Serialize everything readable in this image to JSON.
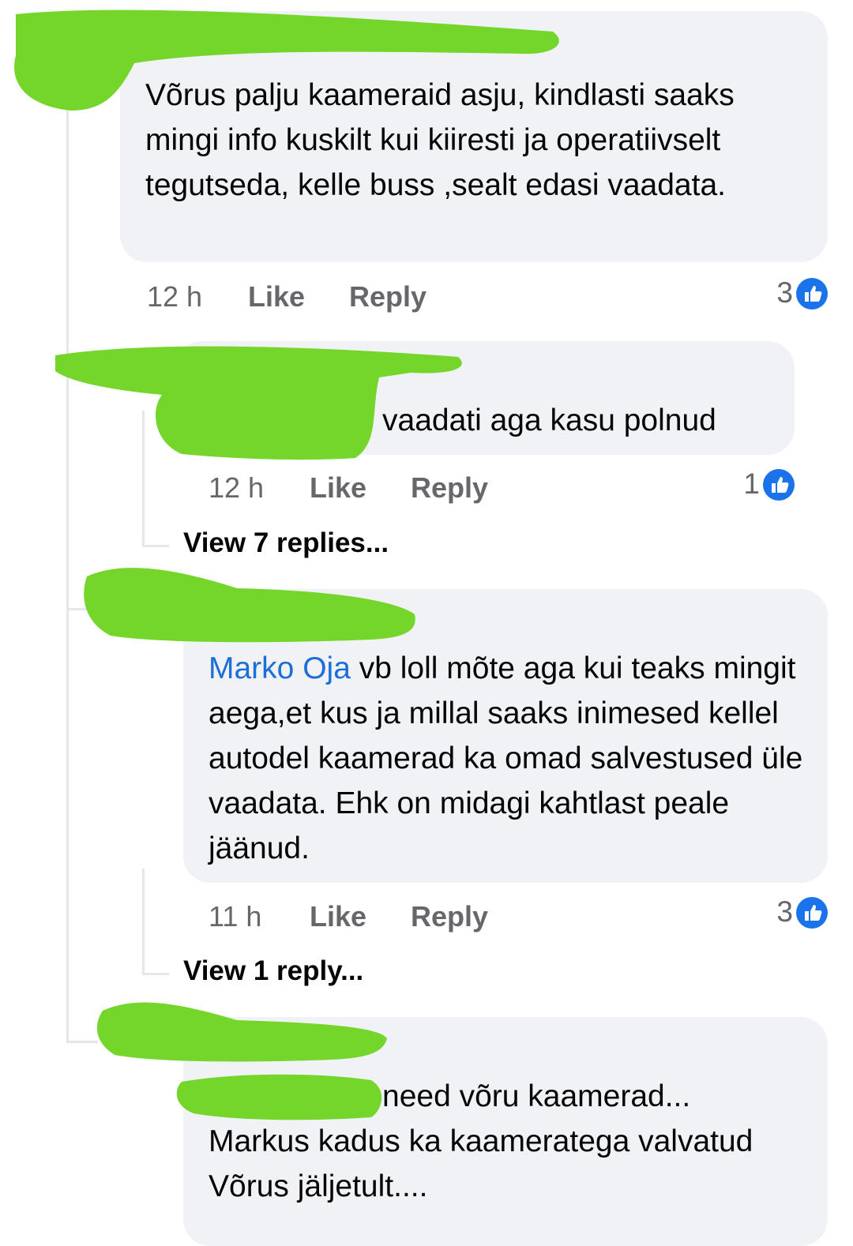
{
  "colors": {
    "bubble": "#f0f2f5",
    "mention": "#1b6fd6",
    "like_badge": "#1a73ea",
    "redaction": "#74d62a"
  },
  "comments": [
    {
      "text": "Võrus palju kaameraid asju, kindlasti saaks mingi info kuskilt kui kiiresti ja operatiivselt tegutseda, kelle buss ,sealt edasi vaadata.",
      "time": "12 h",
      "like_label": "Like",
      "reply_label": "Reply",
      "reactions": "3"
    },
    {
      "text": "vaadati aga kasu polnud",
      "time": "12 h",
      "like_label": "Like",
      "reply_label": "Reply",
      "reactions": "1",
      "view_replies": "View 7 replies..."
    },
    {
      "mention": "Marko Oja",
      "text": " vb loll mõte aga kui teaks mingit aega,et kus ja millal saaks inimesed kellel autodel kaamerad ka omad salvestused üle vaadata.  Ehk on midagi kahtlast peale jäänud.",
      "time": "11 h",
      "like_label": "Like",
      "reply_label": "Reply",
      "reactions": "3",
      "view_replies": "View 1 reply..."
    },
    {
      "text": "need võru kaamerad... Markus kadus ka kaameratega valvatud Võrus jäljetult...."
    }
  ]
}
